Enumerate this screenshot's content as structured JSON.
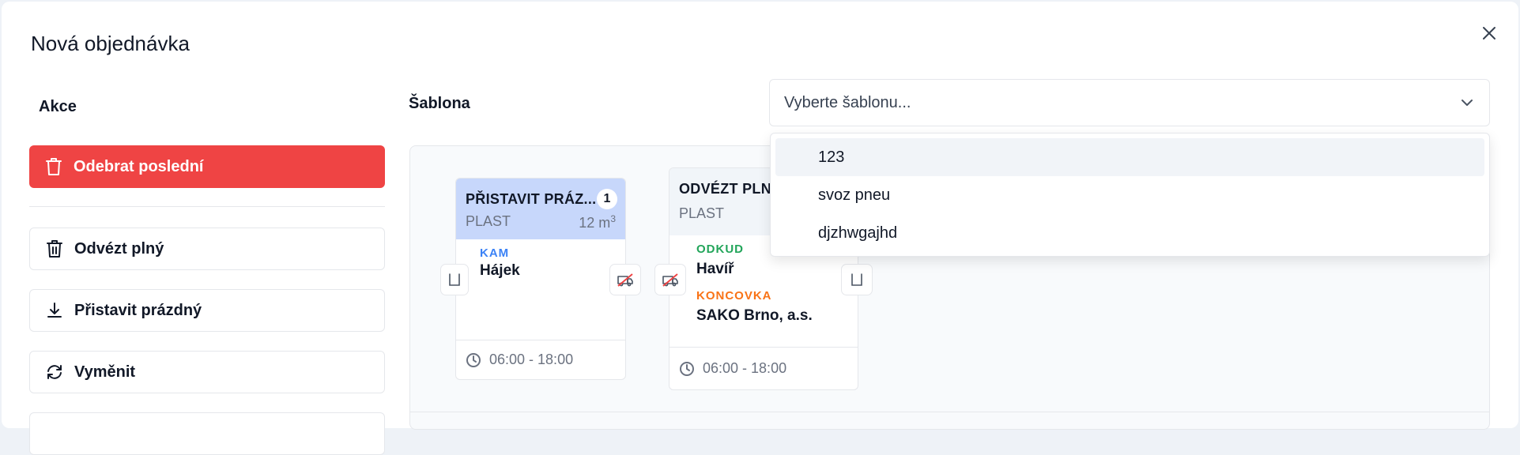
{
  "modal": {
    "title": "Nová objednávka"
  },
  "akce": {
    "label": "Akce",
    "remove_last": "Odebrat poslední",
    "actions": [
      "Odvézt plný",
      "Přistavit prázdný",
      "Vyměnit"
    ]
  },
  "sablona": {
    "label": "Šablona",
    "placeholder": "Vyberte šablonu...",
    "options": [
      "123",
      "svoz pneu",
      "djzhwgajhd"
    ]
  },
  "cards": [
    {
      "title": "PŘISTAVIT PRÁZ...",
      "badge": "1",
      "material": "PLAST",
      "volume": "12 m",
      "volume_unit_sup": "3",
      "to_label": "KAM",
      "to_value": "Hájek",
      "time": "06:00 - 18:00"
    },
    {
      "title": "ODVÉZT PLN",
      "material": "PLAST",
      "from_label": "ODKUD",
      "from_value": "Havíř",
      "end_label": "KONCOVKA",
      "end_value": "SAKO Brno, a.s.",
      "time": "06:00 - 18:00"
    }
  ],
  "colors": {
    "danger": "#ef4444",
    "card_header_active": "#c7d7fb",
    "label_blue": "#3b82f6",
    "label_green": "#22a55a",
    "label_orange": "#f97316"
  }
}
